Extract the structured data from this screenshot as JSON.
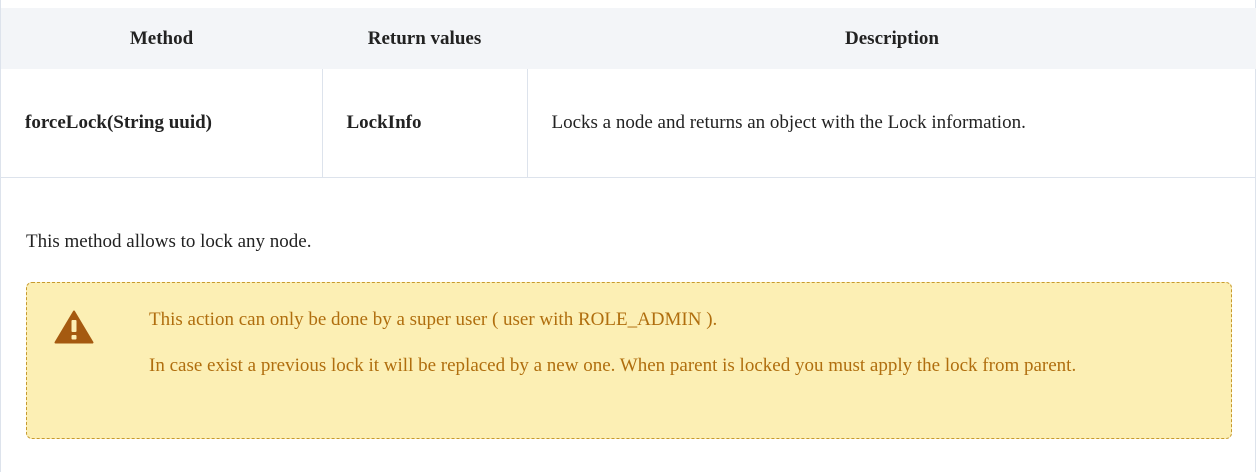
{
  "table": {
    "headers": [
      "Method",
      "Return values",
      "Description"
    ],
    "rows": [
      {
        "method": "forceLock(String uuid)",
        "return_value": "LockInfo",
        "description": "Locks a node and returns an object with the Lock information."
      }
    ]
  },
  "body_text": "This method allows to lock any node.",
  "warning": {
    "icon": "warning-triangle-icon",
    "line1": "This action can only be done by a super user ( user with ROLE_ADMIN ).",
    "line2": "In case exist a previous lock it will be replaced by a new one. When parent is locked you must apply the lock from parent."
  },
  "colors": {
    "header_bg": "#f3f5f8",
    "warning_bg": "#fcefb4",
    "warning_text": "#b06e0e",
    "warning_border": "#c79a2e",
    "icon": "#a55a10"
  }
}
